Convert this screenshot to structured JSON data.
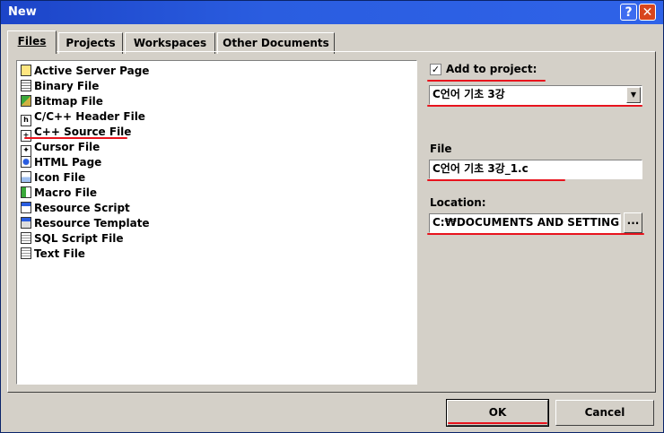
{
  "window": {
    "title": "New"
  },
  "title_buttons": {
    "help": "?",
    "close": "✕"
  },
  "tabs": [
    {
      "label": "Files",
      "active": true
    },
    {
      "label": "Projects",
      "active": false
    },
    {
      "label": "Workspaces",
      "active": false
    },
    {
      "label": "Other Documents",
      "active": false
    }
  ],
  "file_types": [
    {
      "label": "Active Server Page",
      "icon": "asp-icon"
    },
    {
      "label": "Binary File",
      "icon": "binary-icon"
    },
    {
      "label": "Bitmap File",
      "icon": "bitmap-icon"
    },
    {
      "label": "C/C++ Header File",
      "icon": "header-icon"
    },
    {
      "label": "C++ Source File",
      "icon": "source-icon",
      "selected": true
    },
    {
      "label": "Cursor File",
      "icon": "cursor-icon"
    },
    {
      "label": "HTML Page",
      "icon": "html-icon"
    },
    {
      "label": "Icon File",
      "icon": "iconfile-icon"
    },
    {
      "label": "Macro File",
      "icon": "macro-icon"
    },
    {
      "label": "Resource Script",
      "icon": "resource-script-icon"
    },
    {
      "label": "Resource Template",
      "icon": "resource-template-icon"
    },
    {
      "label": "SQL Script File",
      "icon": "sql-icon"
    },
    {
      "label": "Text File",
      "icon": "text-icon"
    }
  ],
  "add_to_project": {
    "label": "Add to project:",
    "checked": true,
    "check_mark": "✓",
    "value": "C언어 기초 3강"
  },
  "file": {
    "label": "File",
    "value": "C언어 기초 3강_1.c"
  },
  "location": {
    "label": "Location:",
    "value": "C:₩DOCUMENTS AND SETTINGS",
    "browse_label": "..."
  },
  "buttons": {
    "ok": "OK",
    "cancel": "Cancel"
  },
  "annotation_color": "#e8131d"
}
